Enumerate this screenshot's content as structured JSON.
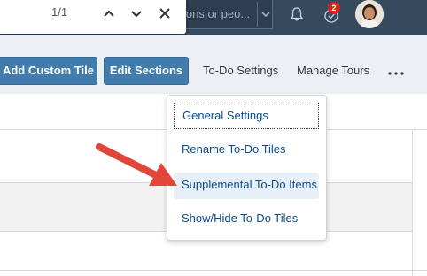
{
  "find_bar": {
    "match_count": "1/1",
    "icons": [
      "chevron-up-icon",
      "chevron-down-icon",
      "close-icon"
    ]
  },
  "header": {
    "search_placeholder_visible": "ions or peo...",
    "notification_badge": "2",
    "colors": {
      "bar": "#354a5f",
      "badge": "#d0271d"
    }
  },
  "toolbar": {
    "add_custom_tile": "Add Custom Tile",
    "edit_sections": "Edit Sections",
    "todo_settings": "To-Do Settings",
    "manage_tours": "Manage Tours",
    "more_icon": "more-icon"
  },
  "menu": {
    "items": [
      {
        "label": "General Settings"
      },
      {
        "label": "Rename To-Do Tiles"
      },
      {
        "label": "Supplemental To-Do Items"
      },
      {
        "label": "Show/Hide To-Do Tiles"
      }
    ]
  },
  "annotation": {
    "arrow_color": "#e0463a"
  },
  "theme": {
    "button_blue": "#427cac",
    "link_blue": "#0a4b8c",
    "toolbar_bg": "#edf0f3"
  }
}
